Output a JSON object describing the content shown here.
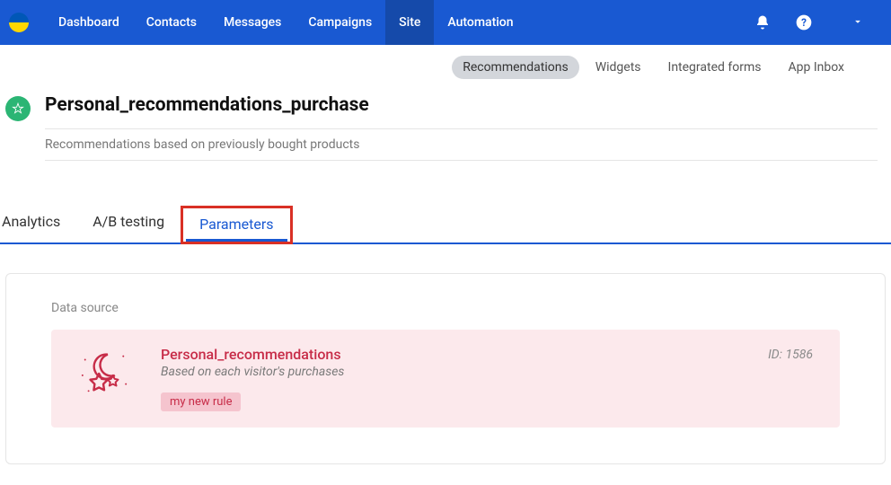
{
  "nav": {
    "items": [
      "Dashboard",
      "Contacts",
      "Messages",
      "Campaigns",
      "Site",
      "Automation"
    ],
    "active_index": 4
  },
  "subnav": {
    "items": [
      "Recommendations",
      "Widgets",
      "Integrated forms",
      "App Inbox"
    ],
    "active_index": 0
  },
  "header": {
    "title": "Personal_recommendations_purchase",
    "subtitle": "Recommendations based on previously bought products"
  },
  "tabs": {
    "items": [
      "Analytics",
      "A/B testing",
      "Parameters"
    ],
    "highlighted_index": 2
  },
  "parameters": {
    "section_label": "Data source",
    "card": {
      "title": "Personal_recommendations",
      "description": "Based on each visitor's purchases",
      "rule_chip": "my new rule",
      "id_label": "ID: 1586"
    }
  }
}
